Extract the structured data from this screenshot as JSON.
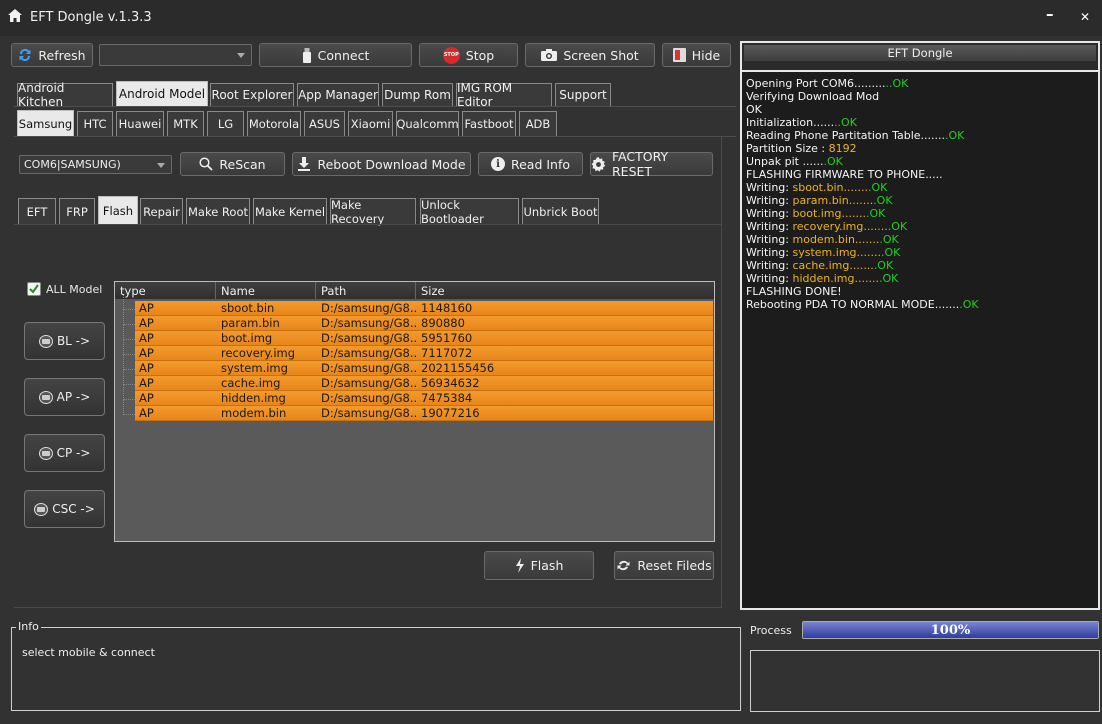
{
  "window": {
    "title": "EFT Dongle  v.1.3.3",
    "minimize": "–",
    "close": "✕"
  },
  "toolbar": {
    "refresh": "Refresh",
    "port_select": "",
    "connect": "Connect",
    "stop": "Stop",
    "stop_badge": "STOP",
    "screenshot": "Screen Shot",
    "hide": "Hide"
  },
  "main_tabs": [
    "Android Kitchen",
    "Android Model",
    "Root Explorer",
    "App Manager",
    "Dump Rom",
    "IMG ROM Editor",
    "Support"
  ],
  "brand_tabs": [
    "Samsung",
    "HTC",
    "Huawei",
    "MTK",
    "LG",
    "Motorola",
    "ASUS",
    "Xiaomi",
    "Qualcomm",
    "Fastboot",
    "ADB"
  ],
  "controls": {
    "com_port": "COM6|SAMSUNG)",
    "rescan": "ReScan",
    "reboot_download": "Reboot  Download Mode",
    "read_info": "Read Info",
    "factory_reset": "FACTORY RESET"
  },
  "func_tabs": [
    "EFT",
    "FRP",
    "Flash",
    "Repair",
    "Make Root",
    "Make Kernel",
    "Make Recovery",
    "Unlock Bootloader",
    "Unbrick Boot"
  ],
  "flash": {
    "all_model_label": "ALL Model",
    "all_model_checked": true,
    "side_buttons": [
      "BL ->",
      "AP ->",
      "CP ->",
      "CSC ->"
    ],
    "columns": [
      "type",
      "Name",
      "Path",
      "Size"
    ],
    "rows": [
      {
        "type": "AP",
        "name": "sboot.bin",
        "path": "D:/samsung/G8...",
        "size": "1148160"
      },
      {
        "type": "AP",
        "name": "param.bin",
        "path": "D:/samsung/G8...",
        "size": "890880"
      },
      {
        "type": "AP",
        "name": "boot.img",
        "path": "D:/samsung/G8...",
        "size": "5951760"
      },
      {
        "type": "AP",
        "name": "recovery.img",
        "path": "D:/samsung/G8...",
        "size": "7117072"
      },
      {
        "type": "AP",
        "name": "system.img",
        "path": "D:/samsung/G8...",
        "size": "2021155456"
      },
      {
        "type": "AP",
        "name": "cache.img",
        "path": "D:/samsung/G8...",
        "size": "56934632"
      },
      {
        "type": "AP",
        "name": "hidden.img",
        "path": "D:/samsung/G8...",
        "size": "7475384"
      },
      {
        "type": "AP",
        "name": "modem.bin",
        "path": "D:/samsung/G8...",
        "size": "19077216"
      }
    ],
    "flash_button": "Flash",
    "reset_button": "Reset Fileds"
  },
  "log": {
    "title": "EFT Dongle",
    "lines": [
      [
        {
          "t": "Opening Port COM6........."
        },
        {
          "t": "..OK",
          "c": "ok"
        }
      ],
      [
        {
          "t": "Verifying Download Mod"
        }
      ],
      [
        {
          "t": "OK"
        }
      ],
      [
        {
          "t": "Initialization......"
        },
        {
          "t": "..OK",
          "c": "ok"
        }
      ],
      [
        {
          "t": "Reading Phone Partitation Table......."
        },
        {
          "t": ".OK",
          "c": "ok"
        }
      ],
      [
        {
          "t": "Partition Size : "
        },
        {
          "t": "8192",
          "c": "yel"
        }
      ],
      [
        {
          "t": "Unpak pit ......"
        },
        {
          "t": ".OK",
          "c": "ok"
        }
      ],
      [
        {
          "t": "FLASHING FIRMWARE TO PHONE....."
        }
      ],
      [
        {
          "t": "Writing: "
        },
        {
          "t": "sboot.bin.......",
          "c": "yel"
        },
        {
          "t": ".OK",
          "c": "ok"
        }
      ],
      [
        {
          "t": "Writing: "
        },
        {
          "t": "param.bin.......",
          "c": "yel"
        },
        {
          "t": ".OK",
          "c": "ok"
        }
      ],
      [
        {
          "t": "Writing: "
        },
        {
          "t": "boot.img.......",
          "c": "yel"
        },
        {
          "t": ".OK",
          "c": "ok"
        }
      ],
      [
        {
          "t": "Writing: "
        },
        {
          "t": "recovery.img.......",
          "c": "yel"
        },
        {
          "t": ".OK",
          "c": "ok"
        }
      ],
      [
        {
          "t": "Writing: "
        },
        {
          "t": "modem.bin.......",
          "c": "yel"
        },
        {
          "t": ".OK",
          "c": "ok"
        }
      ],
      [
        {
          "t": "Writing: "
        },
        {
          "t": "system.img.......",
          "c": "yel"
        },
        {
          "t": ".OK",
          "c": "ok"
        }
      ],
      [
        {
          "t": "Writing: "
        },
        {
          "t": "cache.img.......",
          "c": "yel"
        },
        {
          "t": ".OK",
          "c": "ok"
        }
      ],
      [
        {
          "t": "Writing: "
        },
        {
          "t": "hidden.img.......",
          "c": "yel"
        },
        {
          "t": ".OK",
          "c": "ok"
        }
      ],
      [
        {
          "t": "FLASHING DONE!"
        }
      ],
      [
        {
          "t": "Rebooting PDA TO NORMAL MODE......."
        },
        {
          "t": ".OK",
          "c": "ok"
        }
      ]
    ]
  },
  "info": {
    "legend": "Info",
    "message": "select mobile & connect"
  },
  "process": {
    "label": "Process",
    "percent_text": "100%",
    "fill_fraction": 1.0
  },
  "colors": {
    "ok": "#22d022",
    "highlight": "#f0b21a",
    "row": "#f0952a",
    "accent": "#2d3c9e"
  }
}
